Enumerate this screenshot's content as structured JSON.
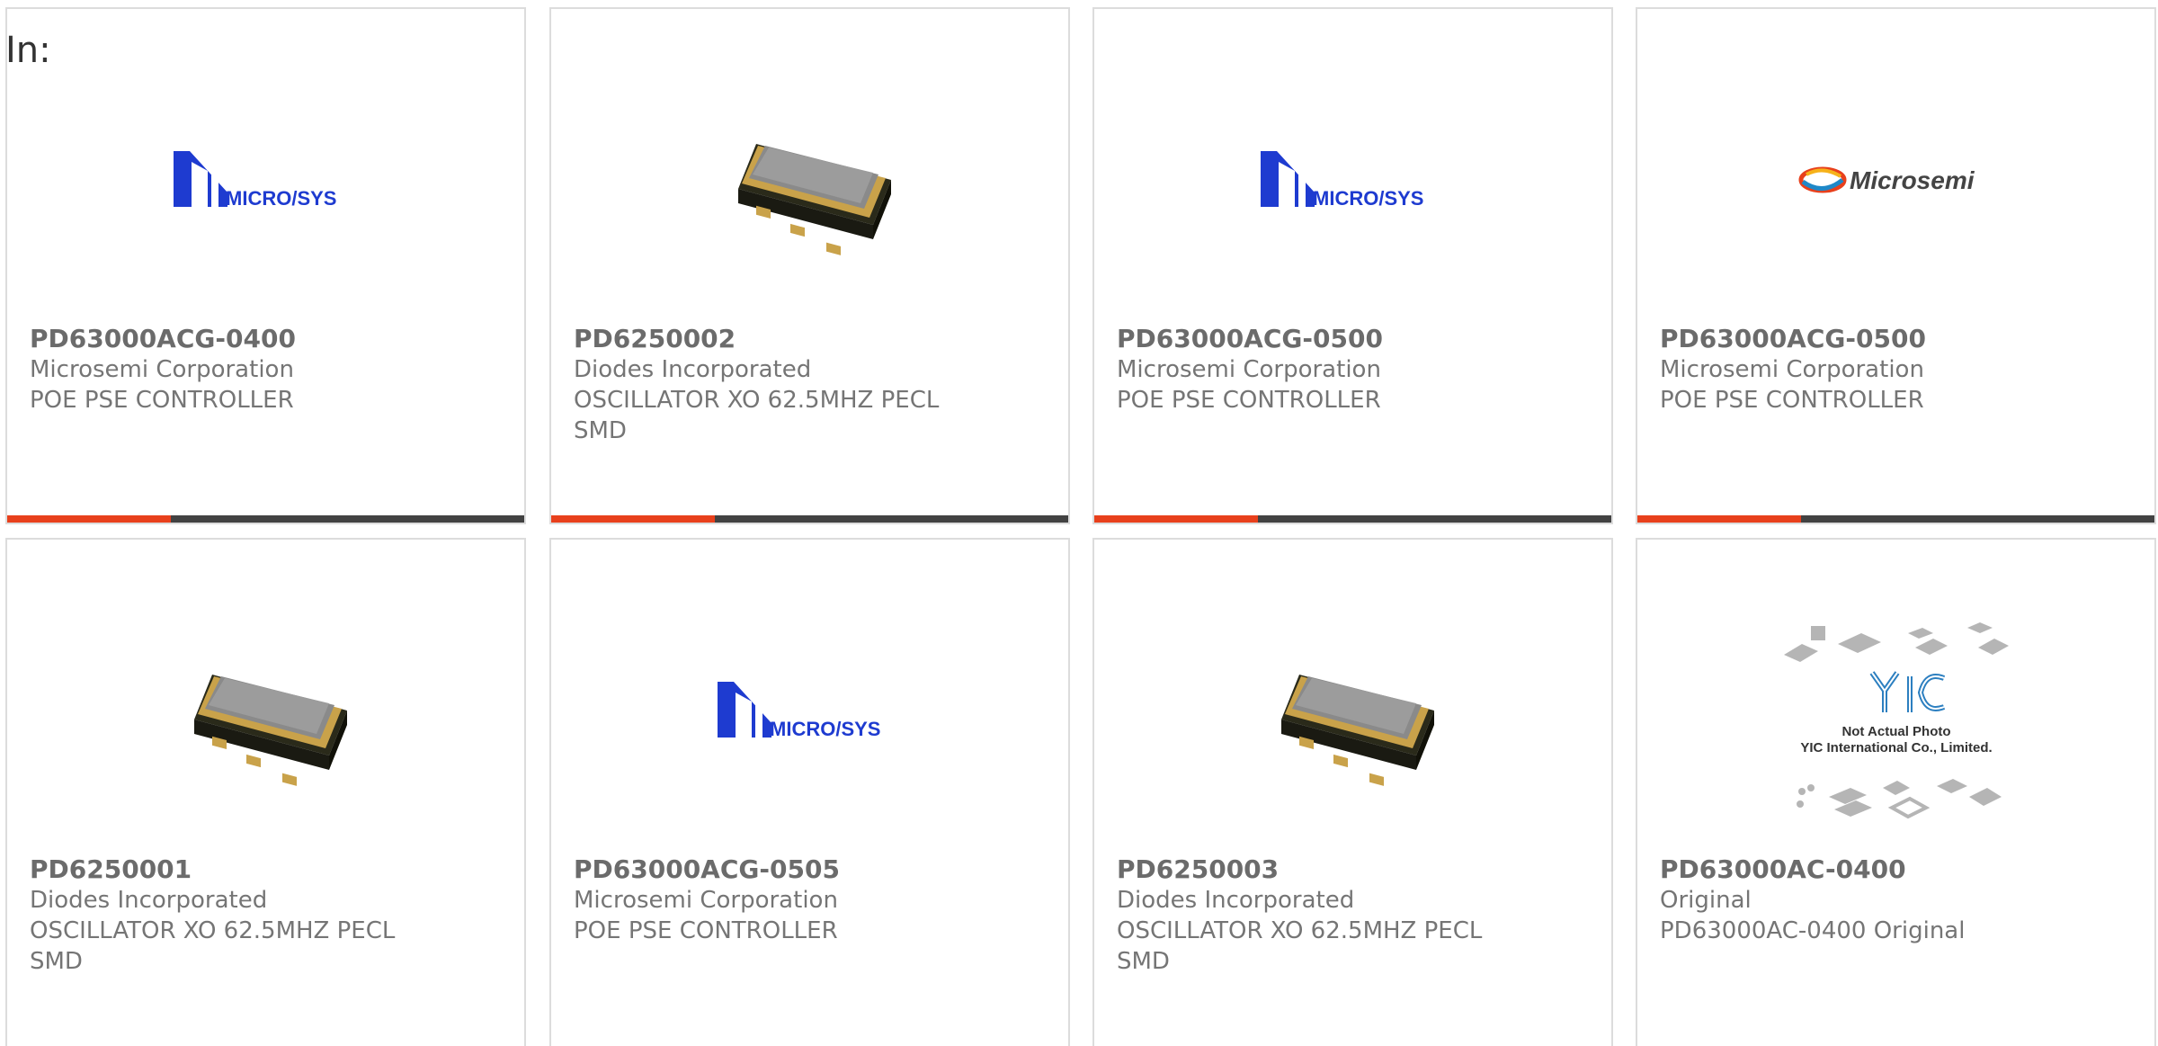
{
  "heading": "In:",
  "colors": {
    "accent": "#e8401c",
    "bar": "#424242",
    "text": "#757575",
    "microsys_blue": "#1e3bd0"
  },
  "products": [
    {
      "part": "PD63000ACG-0400",
      "maker": "Microsemi Corporation",
      "desc": "POE PSE CONTROLLER",
      "image": "microsys-logo"
    },
    {
      "part": "PD6250002",
      "maker": "Diodes Incorporated",
      "desc": "OSCILLATOR XO 62.5MHZ PECL SMD",
      "image": "oscillator-chip"
    },
    {
      "part": "PD63000ACG-0500",
      "maker": "Microsemi Corporation",
      "desc": "POE PSE CONTROLLER",
      "image": "microsys-logo"
    },
    {
      "part": "PD63000ACG-0500",
      "maker": "Microsemi Corporation",
      "desc": "POE PSE CONTROLLER",
      "image": "microsemi-logo"
    },
    {
      "part": "PD6250001",
      "maker": "Diodes Incorporated",
      "desc": "OSCILLATOR XO 62.5MHZ PECL SMD",
      "image": "oscillator-chip"
    },
    {
      "part": "PD63000ACG-0505",
      "maker": "Microsemi Corporation",
      "desc": "POE PSE CONTROLLER",
      "image": "microsys-logo"
    },
    {
      "part": "PD6250003",
      "maker": "Diodes Incorporated",
      "desc": "OSCILLATOR XO 62.5MHZ PECL SMD",
      "image": "oscillator-chip"
    },
    {
      "part": "PD63000AC-0400",
      "maker": "Original",
      "desc": "PD63000AC-0400 Original",
      "image": "yic-placeholder"
    }
  ],
  "logos": {
    "microsys": "MICRO/SYS",
    "microsemi": "Microsemi",
    "yic_line1": "Not Actual Photo",
    "yic_line2": "YIC International Co., Limited.",
    "yic_mark": "YIC"
  }
}
